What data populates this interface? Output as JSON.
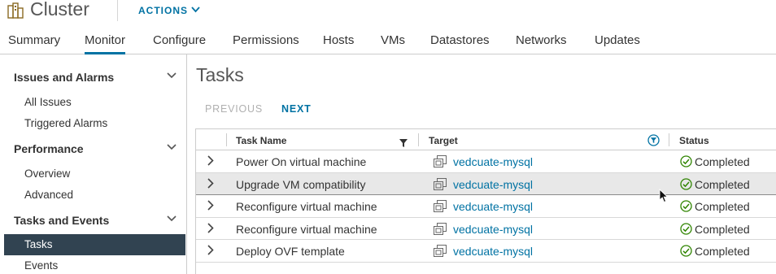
{
  "header": {
    "title": "Cluster",
    "actions_label": "ACTIONS",
    "icon": "cluster-icon"
  },
  "tabs": [
    {
      "label": "Summary",
      "active": false
    },
    {
      "label": "Monitor",
      "active": true
    },
    {
      "label": "Configure",
      "active": false
    },
    {
      "label": "Permissions",
      "active": false
    },
    {
      "label": "Hosts",
      "active": false
    },
    {
      "label": "VMs",
      "active": false
    },
    {
      "label": "Datastores",
      "active": false
    },
    {
      "label": "Networks",
      "active": false
    },
    {
      "label": "Updates",
      "active": false
    }
  ],
  "sidebar": {
    "sections": [
      {
        "title": "Issues and Alarms",
        "items": [
          "All Issues",
          "Triggered Alarms"
        ]
      },
      {
        "title": "Performance",
        "items": [
          "Overview",
          "Advanced"
        ]
      },
      {
        "title": "Tasks and Events",
        "items": [
          "Tasks",
          "Events"
        ]
      }
    ],
    "selected_item": "Tasks"
  },
  "main": {
    "title": "Tasks",
    "pager": {
      "previous": "PREVIOUS",
      "next": "NEXT"
    },
    "table": {
      "columns": [
        "Task Name",
        "Target",
        "Status"
      ],
      "rows": [
        {
          "task": "Power On virtual machine",
          "target": "vedcuate-mysql",
          "status": "Completed"
        },
        {
          "task": "Upgrade VM compatibility",
          "target": "vedcuate-mysql",
          "status": "Completed"
        },
        {
          "task": "Reconfigure virtual machine",
          "target": "vedcuate-mysql",
          "status": "Completed"
        },
        {
          "task": "Reconfigure virtual machine",
          "target": "vedcuate-mysql",
          "status": "Completed"
        },
        {
          "task": "Deploy OVF template",
          "target": "vedcuate-mysql",
          "status": "Completed"
        }
      ],
      "selected_row": 1
    }
  },
  "colors": {
    "accent": "#0072a3",
    "sidebar_selected_bg": "#314351",
    "status_ok": "#2f8400"
  }
}
